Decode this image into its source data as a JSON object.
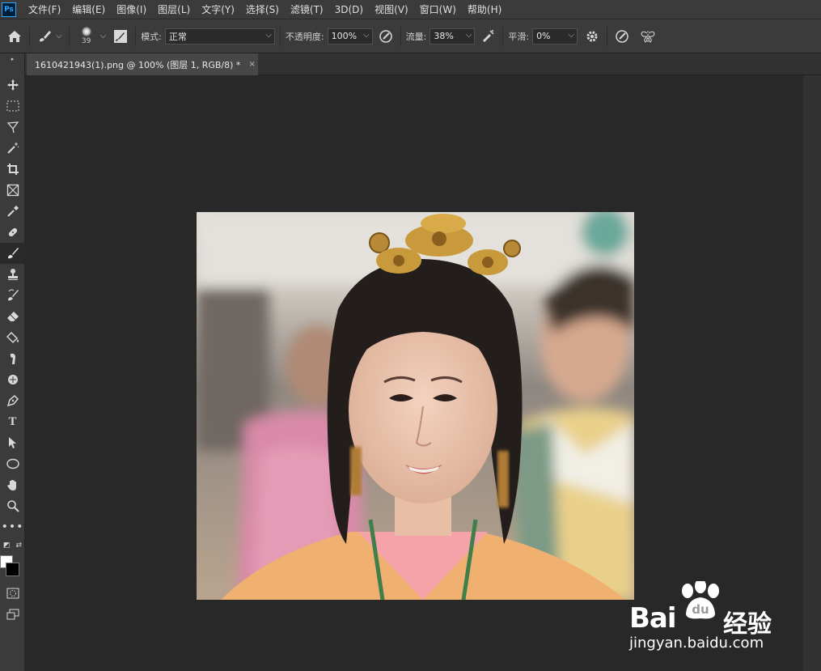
{
  "app": {
    "logo": "Ps"
  },
  "menu": [
    "文件(F)",
    "编辑(E)",
    "图像(I)",
    "图层(L)",
    "文字(Y)",
    "选择(S)",
    "滤镜(T)",
    "3D(D)",
    "视图(V)",
    "窗口(W)",
    "帮助(H)"
  ],
  "options": {
    "brush_size": "39",
    "mode_label": "模式:",
    "mode_value": "正常",
    "opacity_label": "不透明度:",
    "opacity_value": "100%",
    "flow_label": "流量:",
    "flow_value": "38%",
    "smooth_label": "平滑:",
    "smooth_value": "0%"
  },
  "document": {
    "tab_title": "1610421943(1).png @ 100% (图层 1, RGB/8) *",
    "close_glyph": "×"
  },
  "colors": {
    "foreground": "#ffffff",
    "background": "#000000",
    "accent": "#31a8ff"
  },
  "watermark": {
    "brand": "Bai",
    "brand2": "du",
    "cn": "经验",
    "url": "jingyan.baidu.com"
  },
  "icons": [
    "home-icon",
    "brush-icon",
    "brush-settings-icon",
    "airbrush-icon",
    "pressure-size-icon",
    "gear-icon",
    "symmetry-icon"
  ],
  "tools": [
    "move-tool",
    "marquee-tool",
    "lasso-tool",
    "magic-wand-tool",
    "crop-tool",
    "frame-tool",
    "eyedropper-tool",
    "healing-tool",
    "brush-tool",
    "stamp-tool",
    "history-brush-tool",
    "eraser-tool",
    "paint-bucket-tool",
    "smudge-tool",
    "dodge-tool",
    "pen-tool",
    "type-tool",
    "path-select-tool",
    "ellipse-tool",
    "hand-tool",
    "zoom-tool",
    "more-tools"
  ]
}
